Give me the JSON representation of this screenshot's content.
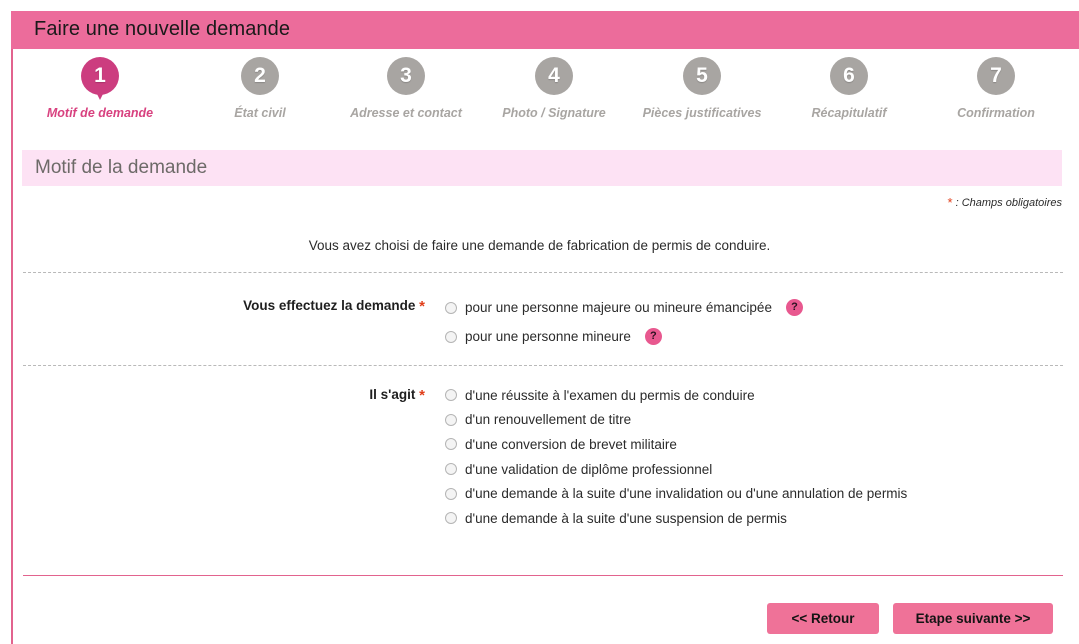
{
  "header": {
    "title": "Faire une nouvelle demande"
  },
  "stepper": {
    "steps": [
      {
        "number": "1",
        "label": "Motif de demande",
        "active": true
      },
      {
        "number": "2",
        "label": "État civil",
        "active": false
      },
      {
        "number": "3",
        "label": "Adresse et contact",
        "active": false
      },
      {
        "number": "4",
        "label": "Photo / Signature",
        "active": false
      },
      {
        "number": "5",
        "label": "Pièces justificatives",
        "active": false
      },
      {
        "number": "6",
        "label": "Récapitulatif",
        "active": false
      },
      {
        "number": "7",
        "label": "Confirmation",
        "active": false
      }
    ]
  },
  "section": {
    "banner_title": "Motif de la demande",
    "required_star": "*",
    "required_note": " : Champs obligatoires",
    "intro_text": "Vous avez choisi de faire une demande de fabrication de permis de conduire."
  },
  "group1": {
    "label": "Vous effectuez la demande ",
    "star": "*",
    "options": [
      {
        "text": "pour une personne majeure ou mineure émancipée",
        "help": "?",
        "selected": false
      },
      {
        "text": "pour une personne mineure",
        "help": "?",
        "selected": false
      }
    ]
  },
  "group2": {
    "label": "Il s'agit ",
    "star": "*",
    "options": [
      {
        "text": "d'une réussite à l'examen du permis de conduire",
        "selected": false
      },
      {
        "text": "d'un renouvellement de titre",
        "selected": false
      },
      {
        "text": "d'une conversion de brevet militaire",
        "selected": false
      },
      {
        "text": "d'une validation de diplôme professionnel",
        "selected": false
      },
      {
        "text": "d'une demande à la suite d'une invalidation ou d'une annulation de permis",
        "selected": false
      },
      {
        "text": "d'une demande à la suite d'une suspension de permis",
        "selected": false
      }
    ]
  },
  "footer": {
    "back_label": "<<  Retour",
    "next_label": "Etape suivante  >>"
  },
  "colors": {
    "header_pink": "#ec6c9b",
    "active_step": "#cc3d7f",
    "inactive_step": "#a8a5a2",
    "banner_pink": "#fde2f4",
    "button_pink": "#ef7298",
    "rule_pink": "#e2638e",
    "required_red": "#e03e1a",
    "help_pink": "#e8588f"
  }
}
